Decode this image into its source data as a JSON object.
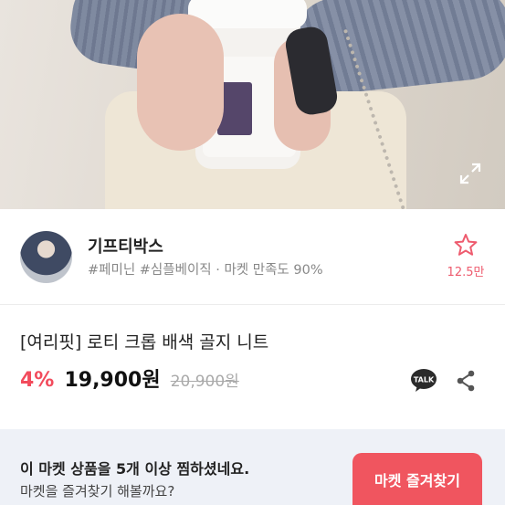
{
  "hero": {
    "icon": "expand-icon"
  },
  "seller": {
    "name": "기프티박스",
    "tags": "#페미닌 #심플베이직 · 마켓 만족도 90%",
    "favorite_icon": "star-outline-icon",
    "favorite_count": "12.5만"
  },
  "product": {
    "title": "[여리핏] 로티 크롭 배색 골지 니트",
    "discount": "4%",
    "price": "19,900원",
    "original_price": "20,900원",
    "talk_label": "TALK",
    "share_icon": "share-icon"
  },
  "banner": {
    "line1": "이 마켓 상품을 5개 이상 찜하셨네요.",
    "line2": "마켓을 즐겨찾기 해볼까요?",
    "button_label": "마켓 즐겨찾기"
  },
  "colors": {
    "accent": "#f24b5c",
    "button": "#f0555f",
    "banner_bg": "#eef1f7"
  }
}
